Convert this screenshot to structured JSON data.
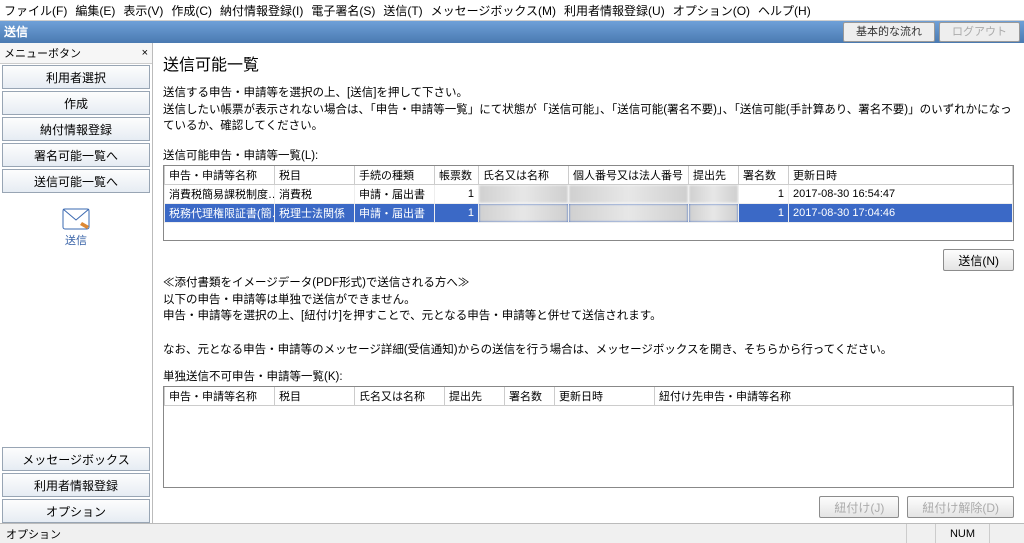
{
  "menu": {
    "file": "ファイル(F)",
    "edit": "編集(E)",
    "view": "表示(V)",
    "create": "作成(C)",
    "payment": "納付情報登録(I)",
    "sign": "電子署名(S)",
    "send": "送信(T)",
    "msgbox": "メッセージボックス(M)",
    "userinfo": "利用者情報登録(U)",
    "option": "オプション(O)",
    "help": "ヘルプ(H)"
  },
  "titlebar": {
    "title": "送信",
    "btn_flow": "基本的な流れ",
    "btn_logout": "ログアウト"
  },
  "sidebar": {
    "panel_title": "メニューボタン",
    "items": {
      "user_select": "利用者選択",
      "create": "作成",
      "payment": "納付情報登録",
      "to_sign_list": "署名可能一覧へ",
      "to_send_list": "送信可能一覧へ"
    },
    "icon_label": "送信",
    "bottom": {
      "msgbox": "メッセージボックス",
      "userinfo": "利用者情報登録",
      "option": "オプション"
    }
  },
  "main": {
    "heading": "送信可能一覧",
    "instruction_line1": "送信する申告・申請等を選択の上、[送信]を押して下さい。",
    "instruction_line2": "送信したい帳票が表示されない場合は、「申告・申請等一覧」にて状態が「送信可能」、「送信可能(署名不要)」、「送信可能(手計算あり、署名不要)」のいずれかになっているか、確認してください。",
    "list1_label": "送信可能申告・申請等一覧(L):",
    "table1": {
      "headers": {
        "name": "申告・申請等名称",
        "tax": "税目",
        "proc": "手続の種類",
        "count": "帳票数",
        "person": "氏名又は名称",
        "num": "個人番号又は法人番号",
        "dest": "提出先",
        "sigs": "署名数",
        "updated": "更新日時"
      },
      "rows": [
        {
          "name": "消費税簡易課税制度…",
          "tax": "消費税",
          "proc": "申請・届出書",
          "count": "1",
          "person": "",
          "num": "",
          "dest": "",
          "sigs": "1",
          "updated": "2017-08-30 16:54:47",
          "selected": false,
          "blur": true
        },
        {
          "name": "税務代理権限証書(簡…",
          "tax": "税理士法関係",
          "proc": "申請・届出書",
          "count": "1",
          "person": "",
          "num": "",
          "dest": "",
          "sigs": "1",
          "updated": "2017-08-30 17:04:46",
          "selected": true,
          "blur": true
        }
      ]
    },
    "send_btn": "送信(N)",
    "attach_text_l1": "≪添付書類をイメージデータ(PDF形式)で送信される方へ≫",
    "attach_text_l2": "以下の申告・申請等は単独で送信ができません。",
    "attach_text_l3": "申告・申請等を選択の上、[紐付け]を押すことで、元となる申告・申請等と併せて送信されます。",
    "attach_text_l4": "なお、元となる申告・申請等のメッセージ詳細(受信通知)からの送信を行う場合は、メッセージボックスを開き、そちらから行ってください。",
    "list2_label": "単独送信不可申告・申請等一覧(K):",
    "table2": {
      "headers": {
        "name": "申告・申請等名称",
        "tax": "税目",
        "person": "氏名又は名称",
        "dest": "提出先",
        "sigs": "署名数",
        "updated": "更新日時",
        "linked": "紐付け先申告・申請等名称"
      }
    },
    "btn_link": "紐付け(J)",
    "btn_unlink": "紐付け解除(D)"
  },
  "status": {
    "left": "オプション",
    "num": "NUM"
  }
}
